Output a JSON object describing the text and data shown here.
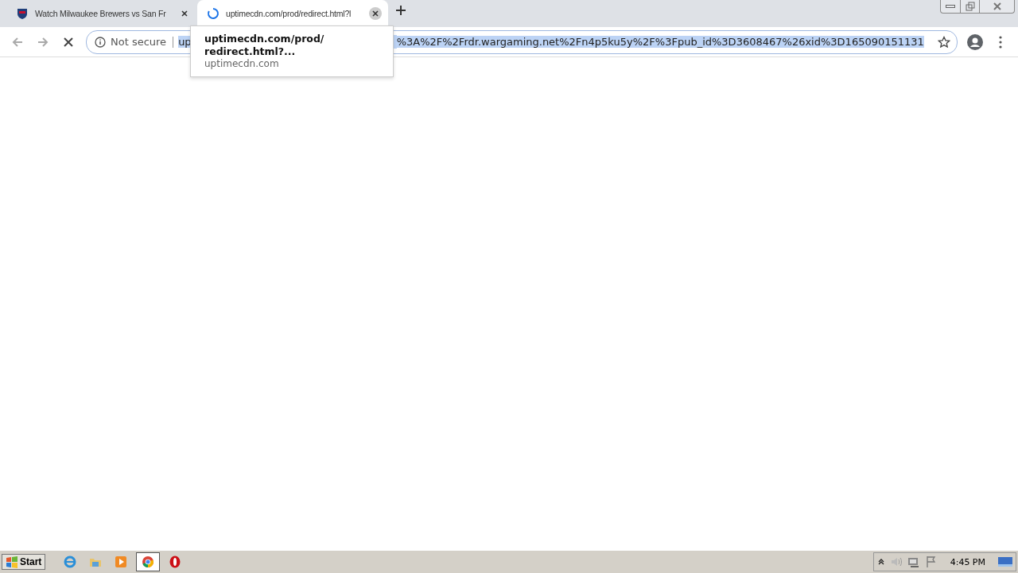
{
  "tabs": [
    {
      "title": "Watch Milwaukee Brewers vs San Fr",
      "selected": false,
      "loading": false
    },
    {
      "title": "uptimecdn.com/prod/redirect.html?l",
      "selected": true,
      "loading": true
    }
  ],
  "address_bar": {
    "security": "Not secure",
    "url_start": "up",
    "url_end": "%3A%2F%2Frdr.wargaming.net%2Fn4p5ku5y%2F%3Fpub_id%3D3608467%26xid%3D165090151131"
  },
  "suggestion": {
    "title": "uptimecdn.com/prod/ redirect.html?...",
    "domain": "uptimecdn.com"
  },
  "taskbar": {
    "start": "Start",
    "clock": "4:45 PM"
  }
}
